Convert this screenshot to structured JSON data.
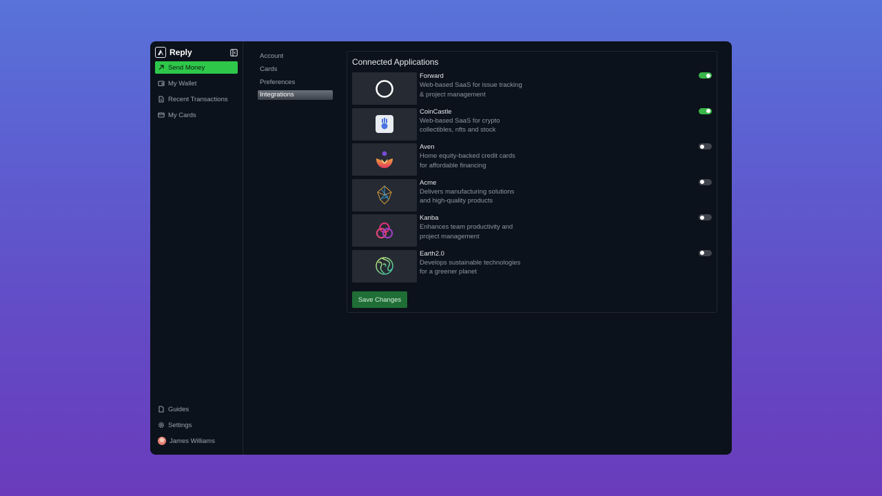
{
  "brand": {
    "name": "Reply"
  },
  "sidebar": {
    "items": [
      {
        "label": "Send Money",
        "icon": "arrow-up-right-icon"
      },
      {
        "label": "My Wallet",
        "icon": "wallet-icon"
      },
      {
        "label": "Recent Transactions",
        "icon": "document-icon"
      },
      {
        "label": "My Cards",
        "icon": "card-icon"
      }
    ],
    "bottom": [
      {
        "label": "Guides",
        "icon": "file-icon"
      },
      {
        "label": "Settings",
        "icon": "gear-icon"
      }
    ],
    "user": {
      "name": "James Williams"
    }
  },
  "subnav": {
    "items": [
      "Account",
      "Cards",
      "Preferences",
      "Integrations"
    ],
    "active": "Integrations"
  },
  "panel": {
    "title": "Connected Applications",
    "apps": [
      {
        "name": "Forward",
        "desc": "Web-based SaaS for issue tracking & project management",
        "enabled": true,
        "icon": "ring-logo-icon"
      },
      {
        "name": "CoinCastle",
        "desc": "Web-based SaaS for crypto collectibles, nfts and stock",
        "enabled": true,
        "icon": "castle-logo-icon"
      },
      {
        "name": "Aven",
        "desc": "Home equity-backed credit cards for affordable financing",
        "enabled": false,
        "icon": "lotus-logo-icon"
      },
      {
        "name": "Acme",
        "desc": "Delivers manufacturing solutions and high-quality products",
        "enabled": false,
        "icon": "crystal-logo-icon"
      },
      {
        "name": "Kanba",
        "desc": "Enhances team productivity and project management",
        "enabled": false,
        "icon": "trefoil-logo-icon"
      },
      {
        "name": "Earth2.0",
        "desc": "Develops sustainable technologies for a greener planet",
        "enabled": false,
        "icon": "globe-logo-icon"
      }
    ],
    "save_label": "Save Changes"
  },
  "colors": {
    "accent": "#2ec74a",
    "toggle_on": "#39b54a",
    "background": "#0c121b"
  }
}
